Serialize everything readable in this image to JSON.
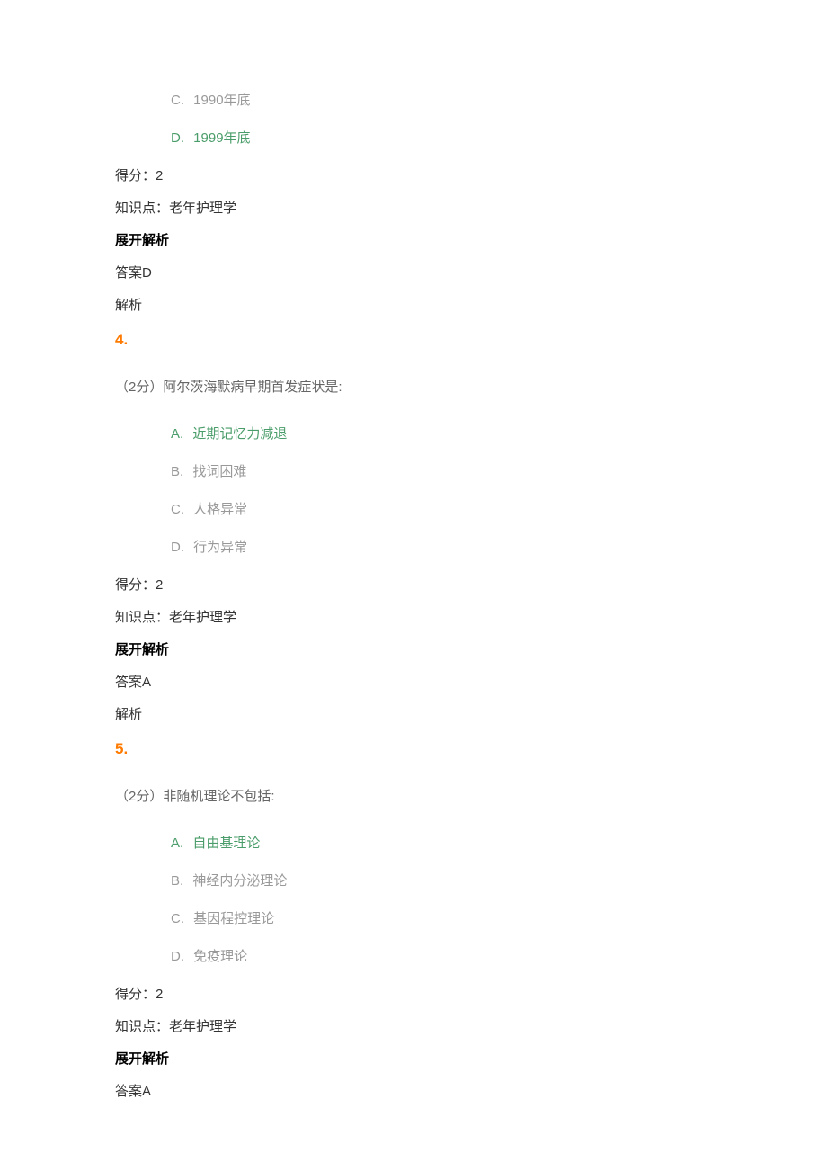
{
  "q3": {
    "options": [
      {
        "letter": "C.",
        "text": "1990年底",
        "green": false
      },
      {
        "letter": "D.",
        "text": "1999年底",
        "green": true
      }
    ],
    "score_label": "得分：",
    "score_value": "2",
    "kp_label": "知识点：",
    "kp_value": "老年护理学",
    "expand": "展开解析",
    "answer_label": "答案",
    "answer_value": "D",
    "explain": "解析"
  },
  "q4": {
    "number": "4.",
    "text": "（2分）阿尔茨海默病早期首发症状是:",
    "options": [
      {
        "letter": "A.",
        "text": "近期记忆力减退",
        "green": true
      },
      {
        "letter": "B.",
        "text": "找词困难",
        "green": false
      },
      {
        "letter": "C.",
        "text": "人格异常",
        "green": false
      },
      {
        "letter": "D.",
        "text": "行为异常",
        "green": false
      }
    ],
    "score_label": "得分：",
    "score_value": "2",
    "kp_label": "知识点：",
    "kp_value": "老年护理学",
    "expand": "展开解析",
    "answer_label": "答案",
    "answer_value": "A",
    "explain": "解析"
  },
  "q5": {
    "number": "5.",
    "text": "（2分）非随机理论不包括:",
    "options": [
      {
        "letter": "A.",
        "text": "自由基理论",
        "green": true
      },
      {
        "letter": "B.",
        "text": "神经内分泌理论",
        "green": false
      },
      {
        "letter": "C.",
        "text": "基因程控理论",
        "green": false
      },
      {
        "letter": "D.",
        "text": "免疫理论",
        "green": false
      }
    ],
    "score_label": "得分：",
    "score_value": "2",
    "kp_label": "知识点：",
    "kp_value": "老年护理学",
    "expand": "展开解析",
    "answer_label": "答案",
    "answer_value": "A"
  }
}
